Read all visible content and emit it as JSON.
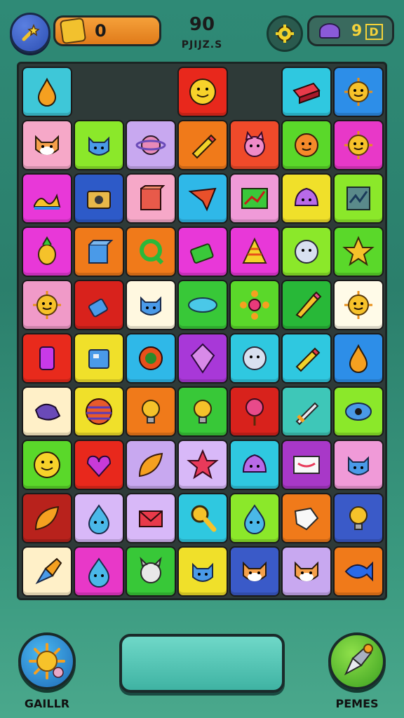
{
  "header": {
    "coins": "0",
    "score": "90",
    "score_label": "PJIJZ.S",
    "lives": "9",
    "lives_suffix": "D",
    "menu_icon": "wand-icon",
    "settings_icon": "gear-icon"
  },
  "bottom": {
    "left_label": "GAILLR",
    "right_label": "PEMES",
    "left_icon": "sun-icon",
    "right_icon": "pen-icon"
  },
  "board": {
    "rows": [
      [
        {
          "c": "#3ec7d8",
          "i": "drop"
        },
        {
          "c": "",
          "i": ""
        },
        {
          "c": "",
          "i": ""
        },
        {
          "c": "#e8281c",
          "i": "smiley"
        },
        {
          "c": "",
          "i": ""
        },
        {
          "c": "#2fc8e0",
          "i": "eraser"
        },
        {
          "c": "#2d8ee8",
          "i": "sun-face"
        }
      ],
      [
        {
          "c": "#f6a8c8",
          "i": "fox"
        },
        {
          "c": "#8be82a",
          "i": "cat"
        },
        {
          "c": "#c8a8f0",
          "i": "planet"
        },
        {
          "c": "#f07a1a",
          "i": "marker"
        },
        {
          "c": "#f04a2a",
          "i": "devil"
        },
        {
          "c": "#5ad82a",
          "i": "orange-face"
        },
        {
          "c": "#e838c8",
          "i": "sun-face"
        }
      ],
      [
        {
          "c": "#e838d8",
          "i": "wave"
        },
        {
          "c": "#2d5ac8",
          "i": "camera"
        },
        {
          "c": "#f6a8c8",
          "i": "box"
        },
        {
          "c": "#2fb8e8",
          "i": "plane"
        },
        {
          "c": "#f09ad8",
          "i": "chart"
        },
        {
          "c": "#f0e02a",
          "i": "blob"
        },
        {
          "c": "#8be82a",
          "i": "graph"
        }
      ],
      [
        {
          "c": "#e838d8",
          "i": "pineapple"
        },
        {
          "c": "#f07a1a",
          "i": "cube"
        },
        {
          "c": "#f07a1a",
          "i": "q"
        },
        {
          "c": "#e838d8",
          "i": "battery"
        },
        {
          "c": "#e838d8",
          "i": "cone"
        },
        {
          "c": "#8be82a",
          "i": "moon"
        },
        {
          "c": "#5ad82a",
          "i": "star-face"
        }
      ],
      [
        {
          "c": "#f09ac8",
          "i": "sun-face"
        },
        {
          "c": "#d8221c",
          "i": "plug"
        },
        {
          "c": "#fff8e0",
          "i": "cat"
        },
        {
          "c": "#38c838",
          "i": "saturn"
        },
        {
          "c": "#5ad82a",
          "i": "flower"
        },
        {
          "c": "#28b838",
          "i": "pencil"
        },
        {
          "c": "#fffbe8",
          "i": "sun-face"
        }
      ],
      [
        {
          "c": "#e82a1c",
          "i": "cup"
        },
        {
          "c": "#f0e02a",
          "i": "robot"
        },
        {
          "c": "#2fb8e8",
          "i": "gear"
        },
        {
          "c": "#a838d8",
          "i": "kite"
        },
        {
          "c": "#2fc8e0",
          "i": "moon"
        },
        {
          "c": "#2fc8e0",
          "i": "marker"
        },
        {
          "c": "#2d8ee8",
          "i": "drop"
        }
      ],
      [
        {
          "c": "#fff0c8",
          "i": "bird"
        },
        {
          "c": "#f0e02a",
          "i": "ball"
        },
        {
          "c": "#f07a1a",
          "i": "bulb"
        },
        {
          "c": "#38c838",
          "i": "bulb"
        },
        {
          "c": "#d8221c",
          "i": "tree"
        },
        {
          "c": "#3ec7b8",
          "i": "sword"
        },
        {
          "c": "#8be82a",
          "i": "eye"
        }
      ],
      [
        {
          "c": "#5ad82a",
          "i": "smiley"
        },
        {
          "c": "#e8281c",
          "i": "heart"
        },
        {
          "c": "#c8a8f0",
          "i": "leaf"
        },
        {
          "c": "#d8b8f8",
          "i": "star"
        },
        {
          "c": "#2fc8e0",
          "i": "blob"
        },
        {
          "c": "#a838c8",
          "i": "mail"
        },
        {
          "c": "#f09ad8",
          "i": "cat"
        }
      ],
      [
        {
          "c": "#b8221c",
          "i": "leaf"
        },
        {
          "c": "#d8b8f8",
          "i": "drop-face"
        },
        {
          "c": "#d8b8f8",
          "i": "envelope"
        },
        {
          "c": "#2fc8e0",
          "i": "magnifier"
        },
        {
          "c": "#8be82a",
          "i": "drop-face"
        },
        {
          "c": "#f07a1a",
          "i": "tag"
        },
        {
          "c": "#3a5ac8",
          "i": "bulb"
        }
      ],
      [
        {
          "c": "#fff0c8",
          "i": "pen"
        },
        {
          "c": "#e838c8",
          "i": "drop-face"
        },
        {
          "c": "#38c838",
          "i": "goat"
        },
        {
          "c": "#f0e02a",
          "i": "cat"
        },
        {
          "c": "#3a5ac8",
          "i": "fox"
        },
        {
          "c": "#c8a8f0",
          "i": "fox"
        },
        {
          "c": "#f07a1a",
          "i": "fish"
        }
      ]
    ]
  },
  "colors": {
    "background": "#2f8a76",
    "board": "#2e3a38",
    "coins_pill": "#f5a13a",
    "lives_text": "#f5d33a"
  }
}
